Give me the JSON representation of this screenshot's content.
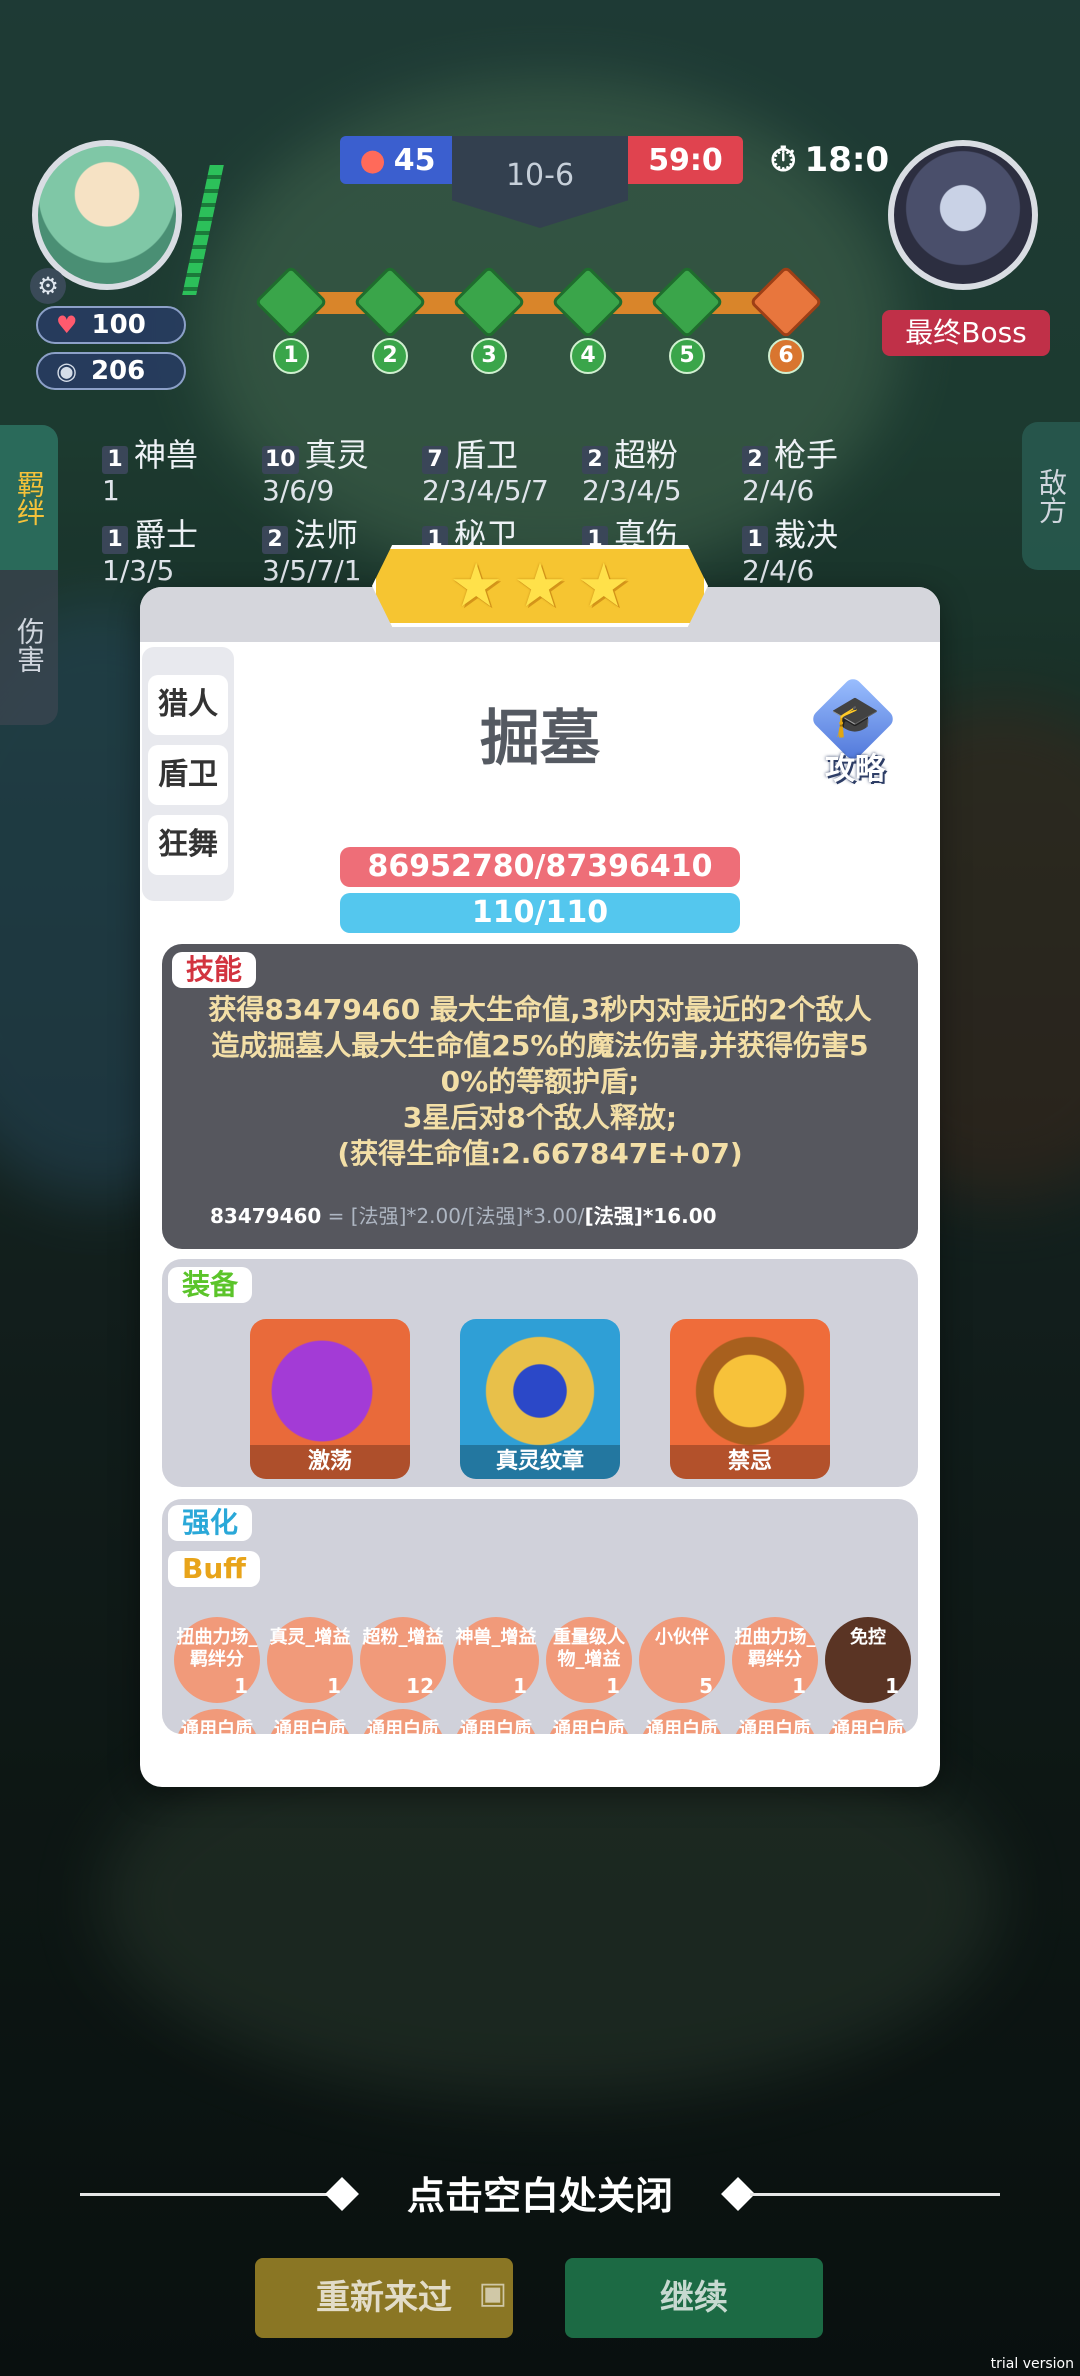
{
  "hud": {
    "hp": "100",
    "gold": "206",
    "score_left": "45",
    "stage": "10-6",
    "score_right": "59:0",
    "timer": "18:0",
    "boss_label": "最终Boss",
    "nodes": [
      "1",
      "2",
      "3",
      "4",
      "5",
      "6"
    ]
  },
  "side_tabs": {
    "bond": "羁绊",
    "damage": "伤害",
    "enemy": "敌方"
  },
  "bonds": [
    {
      "count": "1",
      "name": "神兽",
      "levels": "1"
    },
    {
      "count": "10",
      "name": "真灵",
      "levels": "3/6/9"
    },
    {
      "count": "7",
      "name": "盾卫",
      "levels": "2/3/4/5/7"
    },
    {
      "count": "2",
      "name": "超粉",
      "levels": "2/3/4/5"
    },
    {
      "count": "2",
      "name": "枪手",
      "levels": "2/4/6"
    },
    {
      "count": "1",
      "name": "爵士",
      "levels": "1/3/5"
    },
    {
      "count": "2",
      "name": "法师",
      "levels": "3/5/7/1"
    },
    {
      "count": "1",
      "name": "秘卫",
      "levels": ""
    },
    {
      "count": "1",
      "name": "真伤",
      "levels": ""
    },
    {
      "count": "1",
      "name": "裁决",
      "levels": "2/4/6"
    }
  ],
  "modal": {
    "classes": [
      "猎人",
      "盾卫",
      "狂舞"
    ],
    "hero_name": "掘墓",
    "guide_label": "攻略",
    "hp_bar": "86952780/87396410",
    "mp_bar": "110/110",
    "skill_tag": "技能",
    "skill_lines": [
      "获得83479460 最大生命值,3秒内对最近的2个敌人",
      "造成掘墓人最大生命值25%的魔法伤害,并获得伤害5",
      "0%的等额护盾;",
      "3星后对8个敌人释放;",
      "(获得生命值:2.667847E+07)"
    ],
    "formula_value": "83479460",
    "formula_rest": " = [法强]*2.00/[法强]*3.00/",
    "formula_end": "[法强]*16.00",
    "equip_tag": "装备",
    "equipment": [
      "激荡",
      "真灵纹章",
      "禁忌"
    ],
    "enhance_tag": "强化",
    "buff_tag": "Buff",
    "buffs": [
      {
        "label": "扭曲力场_羁绊分",
        "num": "1"
      },
      {
        "label": "真灵_增益",
        "num": "1"
      },
      {
        "label": "超粉_增益",
        "num": "12"
      },
      {
        "label": "神兽_增益",
        "num": "1"
      },
      {
        "label": "重量级人物_增益",
        "num": "1"
      },
      {
        "label": "小伙伴",
        "num": "5"
      },
      {
        "label": "扭曲力场_羁绊分",
        "num": "1"
      },
      {
        "label": "免控",
        "num": "1"
      }
    ],
    "buffs_row2": [
      "通用白质",
      "通用白质",
      "通用白质",
      "通用白质",
      "通用白质",
      "通用白质",
      "通用白质",
      "通用白质"
    ]
  },
  "footer": {
    "close_hint": "点击空白处关闭",
    "retry": "重新来过",
    "continue": "继续",
    "watermark": "trial version"
  }
}
